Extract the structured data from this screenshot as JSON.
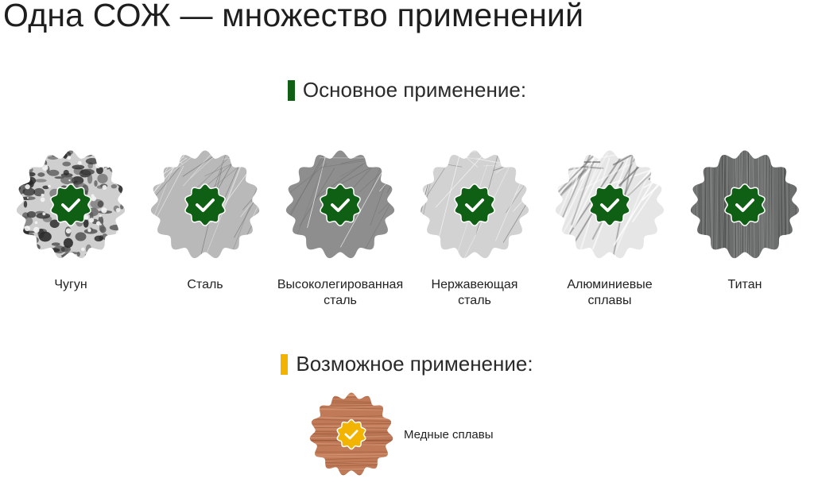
{
  "title": "Одна СОЖ — множество применений",
  "primary": {
    "heading": "Основное применение:",
    "marker_color": "#0f5f14",
    "items": [
      {
        "lines": [
          "Чугун"
        ],
        "texture": "cast-iron",
        "base": "#cfcfcf"
      },
      {
        "lines": [
          "Сталь"
        ],
        "texture": "steel",
        "base": "#b9b9b9"
      },
      {
        "lines": [
          "Высоколегированная",
          "сталь"
        ],
        "texture": "alloy-steel",
        "base": "#8e8e8e"
      },
      {
        "lines": [
          "Нержавеющая",
          "сталь"
        ],
        "texture": "stainless-steel",
        "base": "#d2d2d2"
      },
      {
        "lines": [
          "Алюминиевые",
          "сплавы"
        ],
        "texture": "aluminium",
        "base": "#e6e6e6"
      },
      {
        "lines": [
          "Титан"
        ],
        "texture": "titanium",
        "base": "#6c6e6d"
      }
    ]
  },
  "possible": {
    "heading": "Возможное применение:",
    "marker_color": "#f2b400",
    "item": {
      "label": "Медные сплавы",
      "texture": "copper",
      "base": "#c07a57"
    }
  },
  "colors": {
    "check_primary": "#0f5f14",
    "check_possible": "#f2b400"
  },
  "icons": {
    "primary_check": "checkmark-rosette-icon",
    "possible_check": "checkmark-rosette-icon"
  }
}
